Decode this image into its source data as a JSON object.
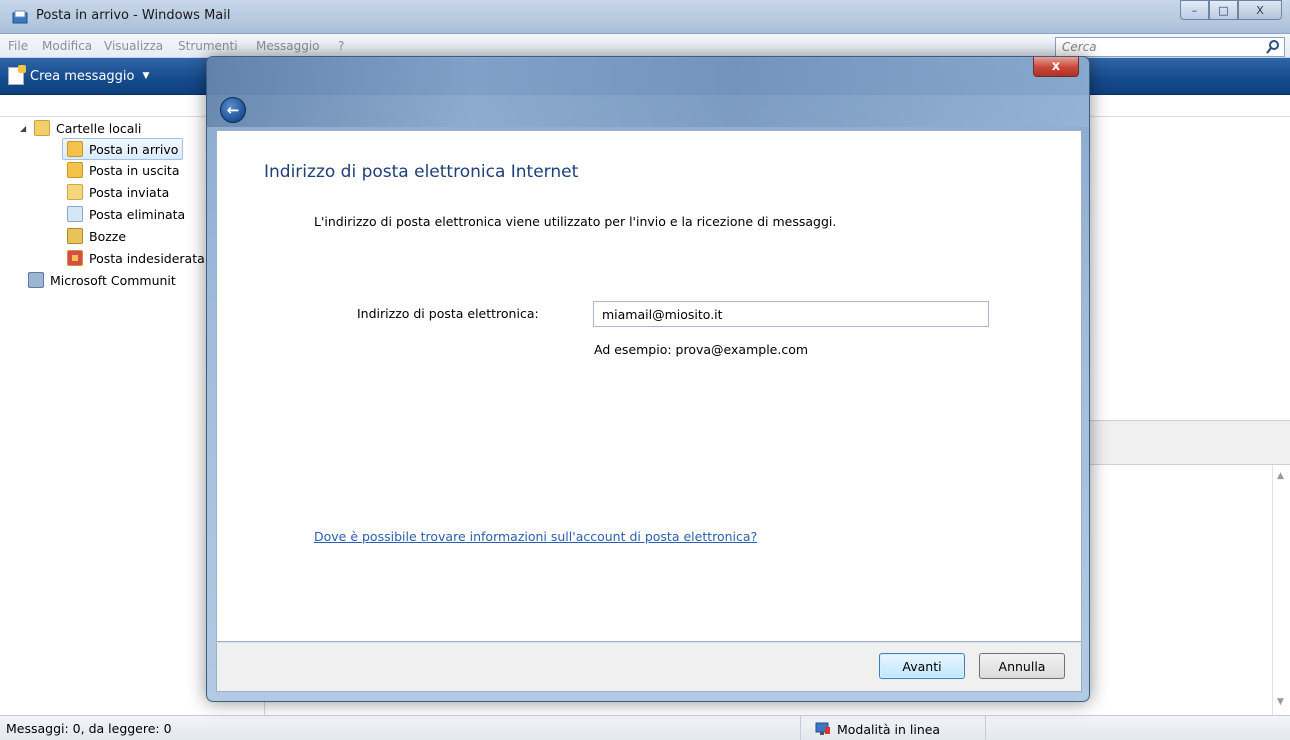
{
  "window": {
    "title": "Posta in arrivo - Windows Mail",
    "minimize_glyph": "–",
    "maximize_glyph": "□",
    "close_glyph": "X"
  },
  "menu": [
    "File",
    "Modifica",
    "Visualizza",
    "Strumenti",
    "Messaggio",
    "?"
  ],
  "search": {
    "placeholder": "Cerca",
    "icon": "search-icon"
  },
  "toolbar": {
    "new_message_label": "Crea messaggio",
    "dropdown_glyph": "▼"
  },
  "folders": {
    "root": "Cartelle locali",
    "items": [
      {
        "label": "Posta in arrivo",
        "icon": "inbox-icon",
        "color": "#f3c24a"
      },
      {
        "label": "Posta in uscita",
        "icon": "outbox-icon",
        "color": "#f3c24a"
      },
      {
        "label": "Posta inviata",
        "icon": "sent-icon",
        "color": "#f3d77a"
      },
      {
        "label": "Posta eliminata",
        "icon": "trash-icon",
        "color": "#b9d3ee"
      },
      {
        "label": "Bozze",
        "icon": "drafts-icon",
        "color": "#e8c25a"
      },
      {
        "label": "Posta indesiderata",
        "icon": "junk-icon",
        "color": "#f3c24a"
      }
    ],
    "communities": "Microsoft Communit"
  },
  "status": {
    "messages": "Messaggi: 0, da leggere: 0",
    "mode": "Modalità in linea"
  },
  "dialog": {
    "close_glyph": "x",
    "heading": "Indirizzo di posta elettronica Internet",
    "description": "L'indirizzo di posta elettronica viene utilizzato per l'invio e la ricezione di messaggi.",
    "field_label": "Indirizzo di posta elettronica:",
    "field_value": "miamail@miosito.it",
    "example": "Ad esempio: prova@example.com",
    "help_link": "Dove è possibile trovare informazioni sull'account di posta elettronica?",
    "next_label": "Avanti",
    "cancel_label": "Annulla"
  },
  "colors": {
    "accent": "#1e3f7a",
    "link": "#2a5fb0",
    "toolbar": "#154b8c"
  }
}
